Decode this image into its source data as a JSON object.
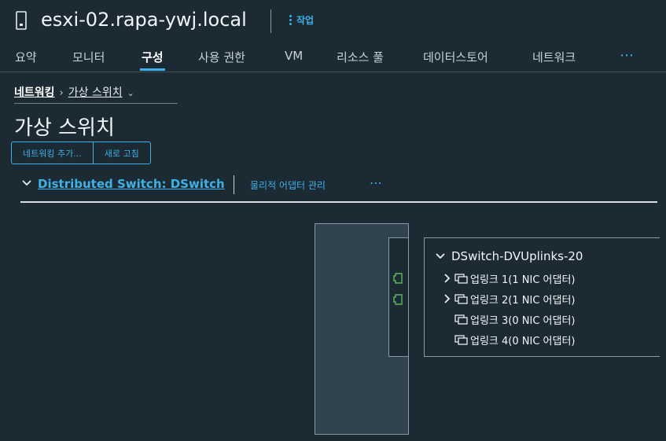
{
  "header": {
    "host_name": "esxi-02.rapa-ywj.local",
    "actions_label": "작업"
  },
  "tabs": [
    {
      "label": "요약"
    },
    {
      "label": "모니터"
    },
    {
      "label": "구성",
      "active": true
    },
    {
      "label": "사용 권한"
    },
    {
      "label": "VM"
    },
    {
      "label": "리소스 풀"
    },
    {
      "label": "데이터스토어"
    },
    {
      "label": "네트워크"
    }
  ],
  "tabs_more": "⋯",
  "breadcrumb": {
    "parent": "네트워킹",
    "separator": "›",
    "current": "가상 스위치",
    "chevron": "⌄"
  },
  "page_title": "가상 스위치",
  "toolbar": {
    "add_networking": "네트워킹 추가...",
    "refresh": "새로 고침"
  },
  "switch": {
    "title": "Distributed Switch: DSwitch",
    "manage_adapters": "물리적 어댑터 관리",
    "more": "⋯"
  },
  "uplinks": {
    "group_name": "DSwitch-DVUplinks-20",
    "items": [
      {
        "label": "업링크 1(1 NIC 어댑터)",
        "expandable": true
      },
      {
        "label": "업링크 2(1 NIC 어댑터)",
        "expandable": true
      },
      {
        "label": "업링크 3(0 NIC 어댑터)",
        "expandable": false
      },
      {
        "label": "업링크 4(0 NIC 어댑터)",
        "expandable": false
      }
    ]
  },
  "colors": {
    "background": "#1b2a33",
    "accent": "#3fb1e6",
    "port_active": "#5cb85c",
    "switch_body": "#2f424d"
  }
}
